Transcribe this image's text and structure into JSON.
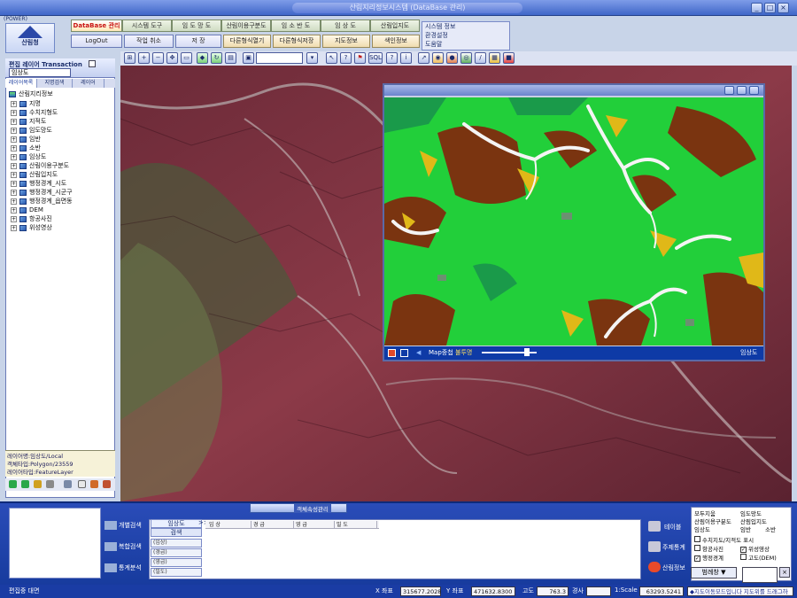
{
  "window": {
    "title": "산림지리정보시스템 (DataBase 관리)",
    "power_label": "(POWER)"
  },
  "logo": {
    "text": "산림청"
  },
  "menu": {
    "top": [
      "DataBase 관리",
      "시스템 도구",
      "임 도 망 도",
      "산림이용구분도",
      "임 소 반 도",
      "임 상 도",
      "산림입지도"
    ],
    "sub": [
      "LogOut",
      "작업 취소",
      "저 장",
      "다른형식열기",
      "다른형식저장",
      "지도정보",
      "색인정보"
    ]
  },
  "right_menu": [
    "시스템 정보",
    "환경설정",
    "도움말"
  ],
  "layer_panel": {
    "header": "편집 레이어 Transaction",
    "selected_layer": "임상도",
    "tabs": [
      "레이어목록",
      "지명검색",
      "레이어"
    ],
    "root": "산림지리정보",
    "items": [
      "지명",
      "수치지형도",
      "지적도",
      "임도망도",
      "임반",
      "소반",
      "임상도",
      "산림이용구분도",
      "산림입지도",
      "행정경계_시도",
      "행정경계_시군구",
      "행정경계_읍면동",
      "DEM",
      "항공사진",
      "위성영상"
    ],
    "info_lines": [
      "레이어명:임상도/Local",
      "객체타입:Polygon/23559",
      "레이어타입:FeatureLayer"
    ]
  },
  "overlay": {
    "buttons": [
      "Map중첩",
      "불투명"
    ],
    "layer": "임상도"
  },
  "bottom": {
    "left_buttons": [
      "개별검색",
      "복합검색",
      "통계분석"
    ],
    "search_layer": "임상도",
    "search_label": "검색",
    "arrow": ">>",
    "combos": [
      "(임상)",
      "(경급)",
      "(영급)",
      "(밀도)"
    ],
    "columns": [
      "임 상",
      "경 급",
      "영 급",
      "밀 도"
    ],
    "right_buttons": [
      "테이블",
      "주제통계",
      "산림정보"
    ],
    "center_tab": "객체속성관리"
  },
  "legend": {
    "col1": [
      "모두지움",
      "산림이용구분도",
      "임상도"
    ],
    "col2": [
      "임도망도",
      "산림입지도",
      "임반",
      "소반"
    ],
    "checks": [
      {
        "label": "수치지도/지적도 표시",
        "on": false
      },
      {
        "label": "항공사진",
        "on": false
      },
      {
        "label": "위성영상",
        "on": true
      },
      {
        "label": "행정경계",
        "on": true
      },
      {
        "label": "고도(DEM)",
        "on": false
      }
    ],
    "dropdown": "범례창"
  },
  "status": {
    "left": "편집중 대면",
    "x_label": "X 좌표",
    "x_value": "315677.2028",
    "y_label": "Y 좌표",
    "y_value": "471632.8300",
    "alt_label": "고도",
    "alt_value": "763.3",
    "slope_label": "경사",
    "scale_label": "1:Scale",
    "scale_value": "63293.5241",
    "message": "◆지도이동모드입니다 지도위를 드래그하"
  }
}
